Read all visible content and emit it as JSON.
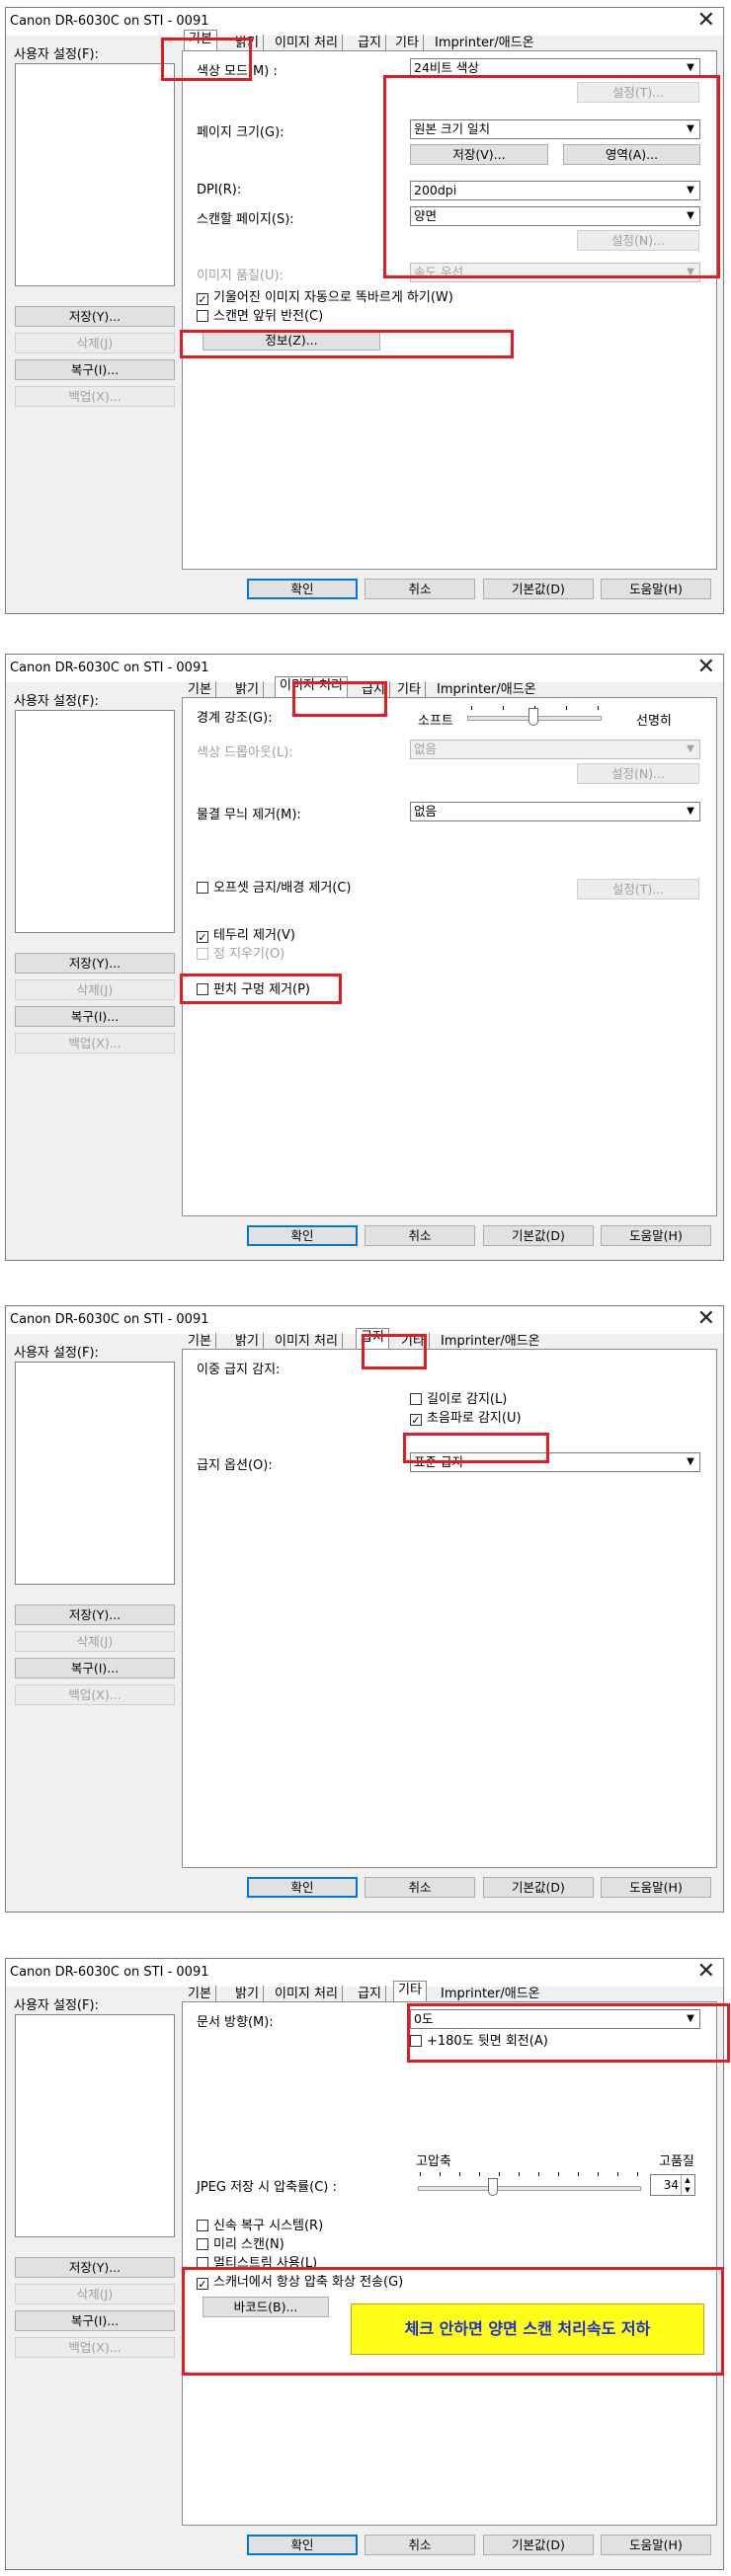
{
  "window_title": "Canon DR-6030C on STI - 0091",
  "close_glyph": "✕",
  "user_settings_label": "사용자 설정(F):",
  "side_buttons": [
    "저장(Y)...",
    "삭제(J)",
    "복구(I)...",
    "백업(X)..."
  ],
  "tabs": [
    "기본",
    "밝기",
    "이미지 처리",
    "급지",
    "기타",
    "Imprinter/애드온"
  ],
  "bottom_buttons": [
    "확인",
    "취소",
    "기본값(D)",
    "도움말(H)"
  ],
  "basic": {
    "color_mode_label": "색상 모드(M) :",
    "color_mode_value": "24비트 색상",
    "settings_btn": "설정(T)...",
    "page_size_label": "페이지 크기(G):",
    "page_size_value": "원본 크기 일치",
    "save_btn": "저장(V)...",
    "area_btn": "영역(A)...",
    "dpi_label": "DPI(R):",
    "dpi_value": "200dpi",
    "scan_side_label": "스캔할 페이지(S):",
    "scan_side_value": "양면",
    "settings2_btn": "설정(N)...",
    "quality_label": "이미지 품질(U):",
    "quality_value": "속도 우선",
    "deskew_label": "기울어진 이미지 자동으로 똑바르게 하기(W)",
    "invert_label": "스캔면 앞뒤 반전(C)",
    "info_btn": "정보(Z)..."
  },
  "image": {
    "edge_label": "경계 강조(G):",
    "soft_label": "소프트",
    "sharp_label": "선명히",
    "edge_level": 0.5,
    "dropout_label": "색상 드롭아웃(L):",
    "dropout_value": "없음",
    "dropout_settings_btn": "설정(N)...",
    "moire_label": "물결 무늬 제거(M):",
    "moire_value": "없음",
    "offset_label": "오프셋 금지/배경 제거(C)",
    "offset_settings_btn": "설정(T)...",
    "border_label": "테두리 제거(V)",
    "fill_label": "정 지우기(O)",
    "punch_label": "펀치 구멍 제거(P)"
  },
  "feed": {
    "double_feed_label": "이중 급지 감지:",
    "length_label": "길이로 감지(L)",
    "ultrasonic_label": "초음파로 감지(U)",
    "feed_option_label": "급지 옵션(O):",
    "feed_option_value": "표준 급지"
  },
  "other": {
    "orientation_label": "문서 방향(M):",
    "orientation_value": "0도",
    "rotate_back_label": "+180도 뒷면 회전(A)",
    "high_compress_label": "고압축",
    "high_quality_label": "고품질",
    "jpeg_label": "JPEG 저장 시 압축률(C) :",
    "jpeg_value": "34",
    "jpeg_level": 0.34,
    "rapid_recovery_label": "신속 복구 시스템(R)",
    "prescan_label": "미리 스캔(N)",
    "multistream_label": "멀티스트림 사용(L)",
    "always_compress_label": "스캐너에서 항상 압축 화상 전송(G)",
    "barcode_btn": "바코드(B)...",
    "note": "체크 안하면 양면 스캔 처리속도 저하"
  },
  "colors": {
    "highlight": "#e31b23",
    "note_bg": "#fffc18",
    "note_text": "#1a2fd0",
    "focus": "#0078d7"
  }
}
